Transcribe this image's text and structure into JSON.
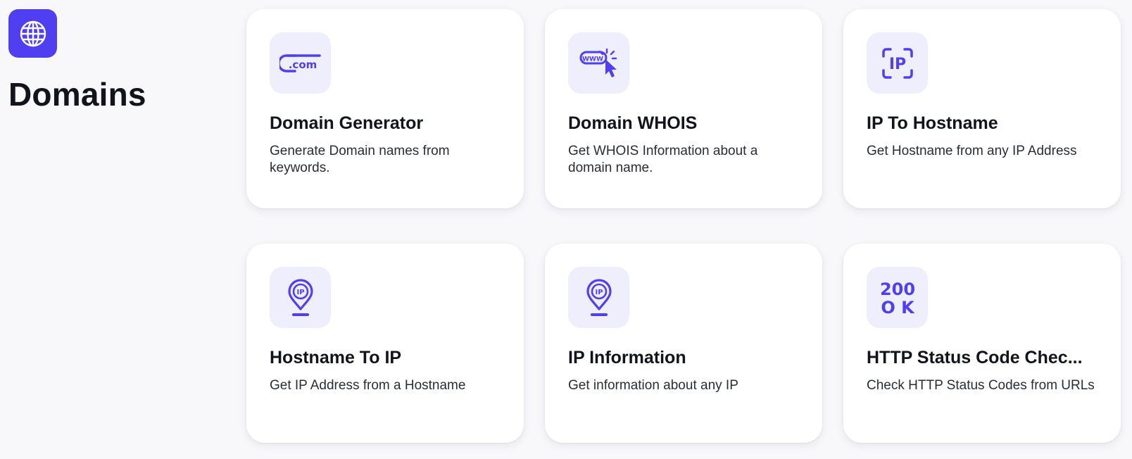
{
  "category": {
    "title": "Domains",
    "icon": "globe-icon",
    "accent_color": "#4f3ff0"
  },
  "tools": [
    {
      "title": "Domain Generator",
      "description": "Generate Domain names from keywords.",
      "icon": "dot-com-icon",
      "icon_text": ".com"
    },
    {
      "title": "Domain WHOIS",
      "description": "Get WHOIS Information about a domain name.",
      "icon": "www-click-icon",
      "icon_text": "WWW"
    },
    {
      "title": "IP To Hostname",
      "description": "Get Hostname from any IP Address",
      "icon": "ip-scan-icon",
      "icon_text": "IP"
    },
    {
      "title": "Hostname To IP",
      "description": "Get IP Address from a Hostname",
      "icon": "ip-location-pin-icon",
      "icon_text": "IP"
    },
    {
      "title": "IP Information",
      "description": "Get information about any IP",
      "icon": "ip-location-pin-icon",
      "icon_text": "IP"
    },
    {
      "title": "HTTP Status Code Chec...",
      "description": "Check HTTP Status Codes from URLs",
      "icon": "http-200-ok-icon",
      "icon_text_line1": "200",
      "icon_text_line2": "O K"
    }
  ]
}
